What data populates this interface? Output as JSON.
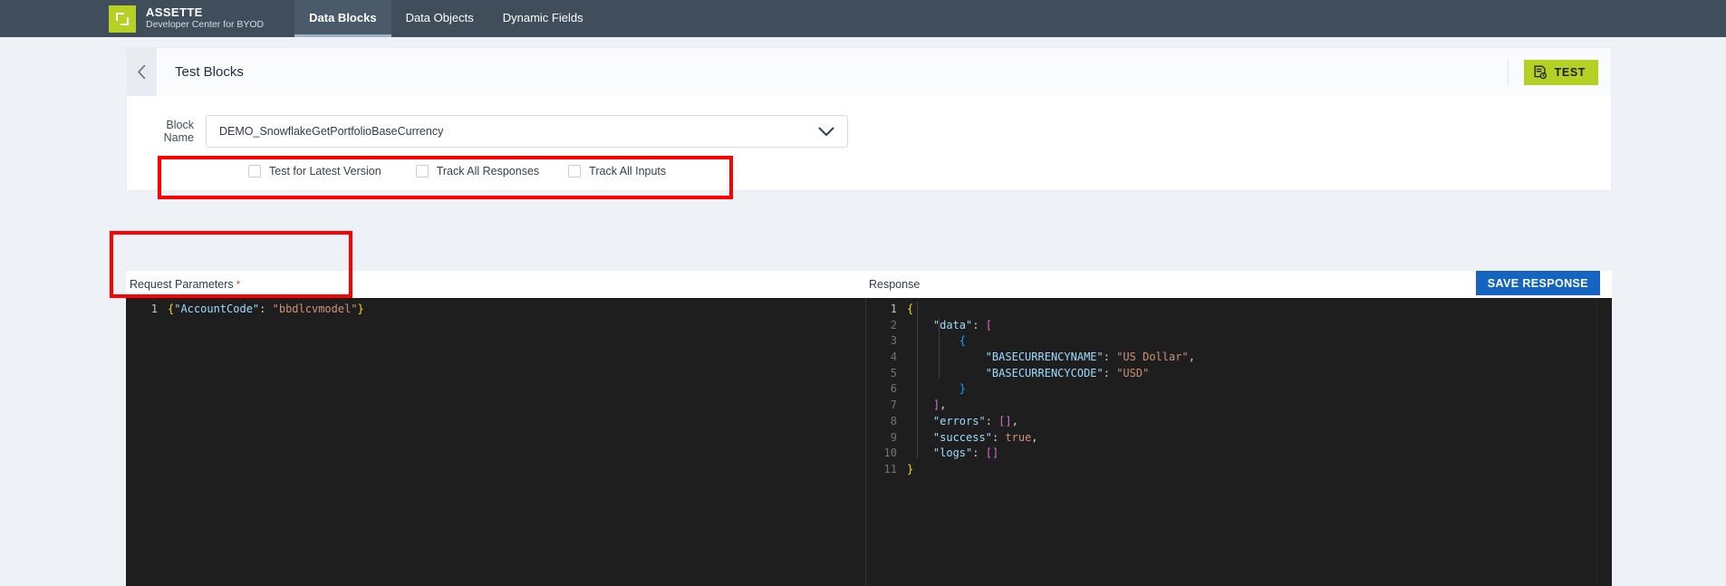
{
  "topbar": {
    "brand": {
      "logo_icon": "brackets-logo-icon",
      "title": "ASSETTE",
      "subtitle": "Developer Center for BYOD",
      "logo_color": "#b5d125"
    },
    "tabs": [
      {
        "label": "Data Blocks",
        "active": true
      },
      {
        "label": "Data Objects",
        "active": false
      },
      {
        "label": "Dynamic Fields",
        "active": false
      }
    ],
    "background_color": "#404e5c"
  },
  "header": {
    "back_icon": "chevron-left-icon",
    "title": "Test Blocks",
    "test_button": {
      "label": "TEST",
      "icon": "test-document-icon",
      "color": "#b5d125"
    }
  },
  "form": {
    "block_name": {
      "label": "Block Name",
      "value": "DEMO_SnowflakeGetPortfolioBaseCurrency",
      "caret_icon": "chevron-down-icon"
    },
    "checkboxes": [
      {
        "label": "Test for Latest Version",
        "checked": false
      },
      {
        "label": "Track All Responses",
        "checked": false
      },
      {
        "label": "Track All Inputs",
        "checked": false
      }
    ]
  },
  "request_panel": {
    "title": "Request Parameters",
    "required_marker": "*",
    "code_lines": [
      {
        "number": "1",
        "active": true,
        "tokens": [
          {
            "t": "{",
            "c": "tk-brace0"
          },
          {
            "t": "\"AccountCode\"",
            "c": "tk-key"
          },
          {
            "t": ":",
            "c": "tk-punc"
          },
          {
            "t": " ",
            "c": "tk-punc"
          },
          {
            "t": "\"bbdlcvmodel\"",
            "c": "tk-str"
          },
          {
            "t": "}",
            "c": "tk-brace0"
          }
        ]
      }
    ]
  },
  "response_panel": {
    "title": "Response",
    "save_button": {
      "label": "SAVE RESPONSE",
      "color": "#1565c0"
    },
    "code_lines": [
      {
        "number": "1",
        "active": true,
        "tokens": [
          {
            "t": "{",
            "c": "tk-brace0"
          }
        ]
      },
      {
        "number": "2",
        "active": false,
        "tokens": [
          {
            "t": "    ",
            "c": "tk-punc"
          },
          {
            "t": "\"data\"",
            "c": "tk-key"
          },
          {
            "t": ": ",
            "c": "tk-punc"
          },
          {
            "t": "[",
            "c": "tk-brace1"
          }
        ]
      },
      {
        "number": "3",
        "active": false,
        "tokens": [
          {
            "t": "        ",
            "c": "tk-punc"
          },
          {
            "t": "{",
            "c": "tk-brace2"
          }
        ]
      },
      {
        "number": "4",
        "active": false,
        "tokens": [
          {
            "t": "            ",
            "c": "tk-punc"
          },
          {
            "t": "\"BASECURRENCYNAME\"",
            "c": "tk-key"
          },
          {
            "t": ": ",
            "c": "tk-punc"
          },
          {
            "t": "\"US Dollar\"",
            "c": "tk-str"
          },
          {
            "t": ",",
            "c": "tk-punc"
          }
        ]
      },
      {
        "number": "5",
        "active": false,
        "tokens": [
          {
            "t": "            ",
            "c": "tk-punc"
          },
          {
            "t": "\"BASECURRENCYCODE\"",
            "c": "tk-key"
          },
          {
            "t": ": ",
            "c": "tk-punc"
          },
          {
            "t": "\"USD\"",
            "c": "tk-str"
          }
        ]
      },
      {
        "number": "6",
        "active": false,
        "tokens": [
          {
            "t": "        ",
            "c": "tk-punc"
          },
          {
            "t": "}",
            "c": "tk-brace2"
          }
        ]
      },
      {
        "number": "7",
        "active": false,
        "tokens": [
          {
            "t": "    ",
            "c": "tk-punc"
          },
          {
            "t": "]",
            "c": "tk-brace1"
          },
          {
            "t": ",",
            "c": "tk-punc"
          }
        ]
      },
      {
        "number": "8",
        "active": false,
        "tokens": [
          {
            "t": "    ",
            "c": "tk-punc"
          },
          {
            "t": "\"errors\"",
            "c": "tk-key"
          },
          {
            "t": ": ",
            "c": "tk-punc"
          },
          {
            "t": "[]",
            "c": "tk-brace1"
          },
          {
            "t": ",",
            "c": "tk-punc"
          }
        ]
      },
      {
        "number": "9",
        "active": false,
        "tokens": [
          {
            "t": "    ",
            "c": "tk-punc"
          },
          {
            "t": "\"success\"",
            "c": "tk-key"
          },
          {
            "t": ": ",
            "c": "tk-punc"
          },
          {
            "t": "true",
            "c": "tk-str"
          },
          {
            "t": ",",
            "c": "tk-punc"
          }
        ]
      },
      {
        "number": "10",
        "active": false,
        "tokens": [
          {
            "t": "    ",
            "c": "tk-punc"
          },
          {
            "t": "\"logs\"",
            "c": "tk-key"
          },
          {
            "t": ": ",
            "c": "tk-punc"
          },
          {
            "t": "[]",
            "c": "tk-brace1"
          }
        ]
      },
      {
        "number": "11",
        "active": false,
        "tokens": [
          {
            "t": "}",
            "c": "tk-brace0"
          }
        ]
      }
    ]
  },
  "annotations": [
    {
      "name": "block-name-highlight",
      "color": "#ff0000"
    },
    {
      "name": "request-parameters-highlight",
      "color": "#ff0000"
    }
  ]
}
